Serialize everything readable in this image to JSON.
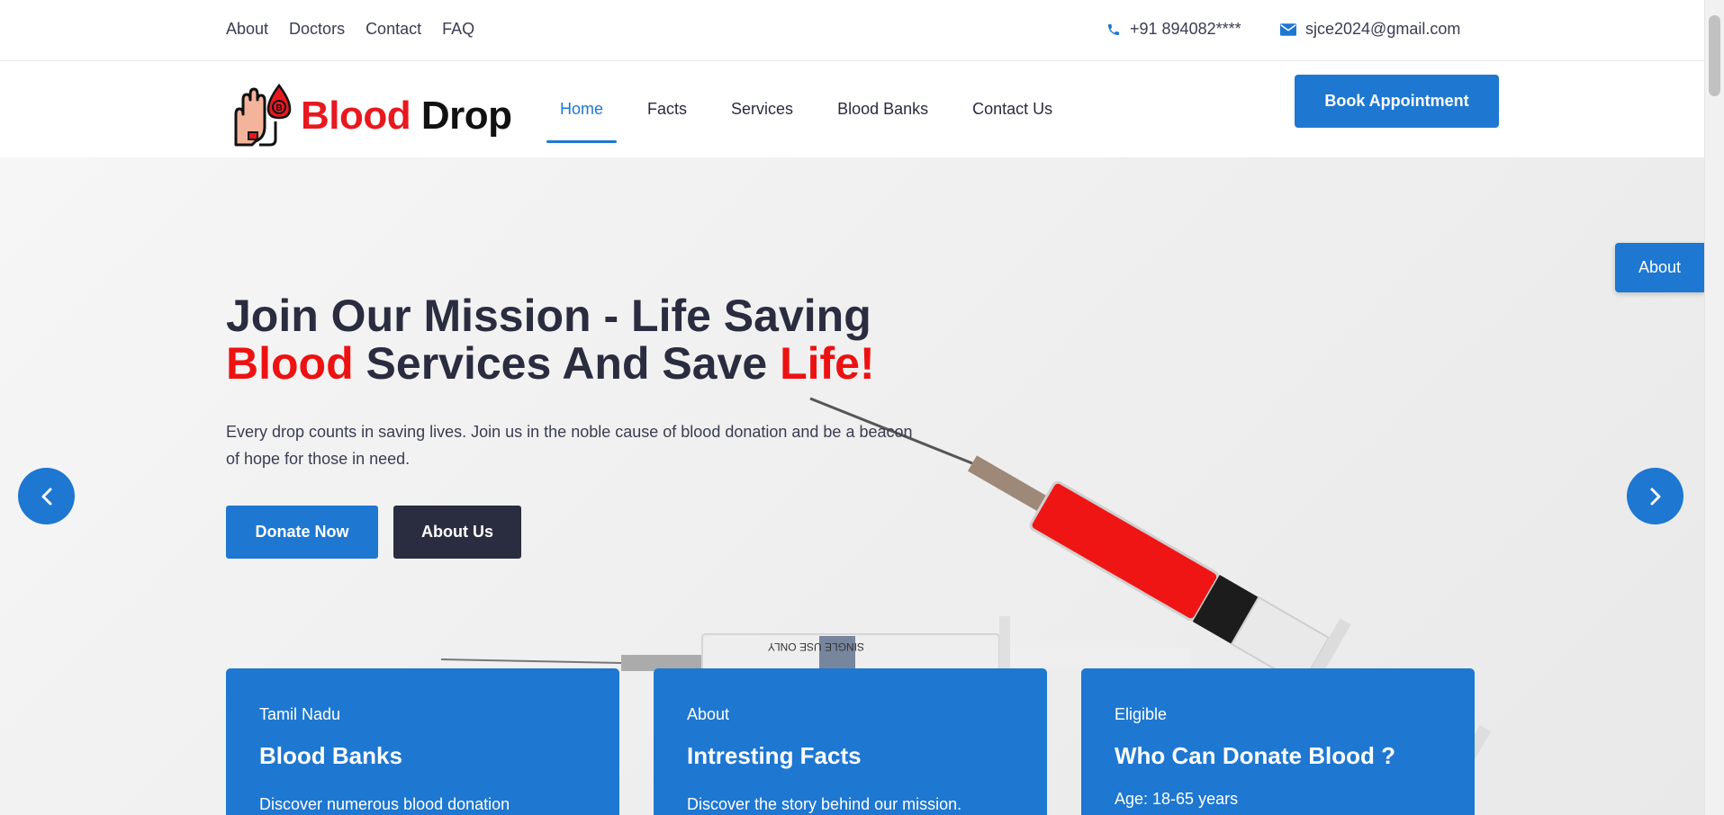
{
  "topbar": {
    "links": [
      "About",
      "Doctors",
      "Contact",
      "FAQ"
    ],
    "phone": "+91 894082****",
    "email": "sjce2024@gmail.com",
    "phone_icon": "phone-icon",
    "email_icon": "envelope-icon"
  },
  "nav": {
    "logo_part1": "Blood",
    "logo_part2": "Drop",
    "items": [
      "Home",
      "Facts",
      "Services",
      "Blood Banks",
      "Contact Us"
    ],
    "active_item": "Home",
    "book_button": "Book Appointment"
  },
  "hero": {
    "title_line1": "Join Our Mission - Life Saving",
    "title_red1": "Blood",
    "title_mid": "Services And Save",
    "title_red2": "Life!",
    "description": "Every drop counts in saving lives. Join us in the noble cause of blood donation and be a beacon of hope for those in need.",
    "donate_button": "Donate Now",
    "about_button": "About Us",
    "side_tab": "About",
    "prev_icon": "chevron-left-icon",
    "next_icon": "chevron-right-icon"
  },
  "cards": [
    {
      "subtitle": "Tamil Nadu",
      "title": "Blood Banks",
      "text": "Discover numerous blood donation"
    },
    {
      "subtitle": "About",
      "title": "Intresting Facts",
      "text": "Discover the story behind our mission."
    },
    {
      "subtitle": "Eligible",
      "title": "Who Can Donate Blood ?",
      "text": "Age: 18-65 years"
    }
  ],
  "colors": {
    "primary": "#1e77d1",
    "dark": "#2a2c3f",
    "accent_red": "#ee1111"
  }
}
